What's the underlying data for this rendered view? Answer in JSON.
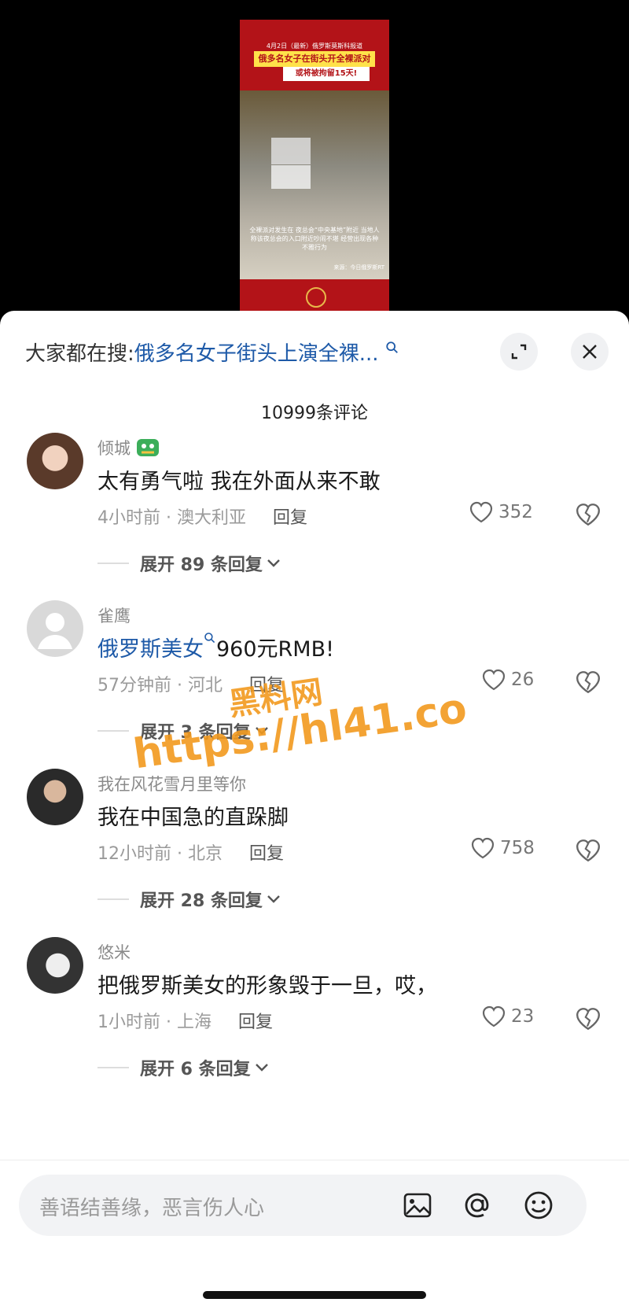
{
  "video": {
    "banner_top": "4月2日（最新）俄罗斯莫斯科报道",
    "banner_title": "俄多名女子在街头开全裸派对",
    "banner_sub": "或将被拘留15天!",
    "caption": "全裸派对发生在 夜总会“中央基地”附近 当地人称该夜总会的入口附近吵闹不堪 经营出现各种不雅行为",
    "source": "来源：今日俄罗斯RT"
  },
  "header": {
    "search_prefix": "大家都在搜:",
    "search_query": "俄多名女子街头上演全裸...",
    "comment_count": "10999条评论"
  },
  "comments": [
    {
      "name": "倾城",
      "text": "太有勇气啦 我在外面从来不敢",
      "meta": "4小时前 · 澳大利亚",
      "reply": "回复",
      "likes": "352",
      "expand": "展开 89 条回复"
    },
    {
      "name": "雀鹰",
      "text_link": "俄罗斯美女",
      "text_rest": "960元RMB!",
      "meta": "57分钟前 · 河北",
      "reply": "回复",
      "likes": "26",
      "expand": "展开 3 条回复"
    },
    {
      "name": "我在风花雪月里等你",
      "text": "我在中国急的直跺脚",
      "meta": "12小时前 · 北京",
      "reply": "回复",
      "likes": "758",
      "expand": "展开 28 条回复"
    },
    {
      "name": "悠米",
      "text": "把俄罗斯美女的形象毁于一旦，哎，",
      "meta": "1小时前 · 上海",
      "reply": "回复",
      "likes": "23",
      "expand": "展开 6 条回复"
    }
  ],
  "input": {
    "placeholder": "善语结善缘，恶言伤人心"
  },
  "watermark": {
    "line1": "黑料网",
    "line2": "https://hl41.co"
  }
}
